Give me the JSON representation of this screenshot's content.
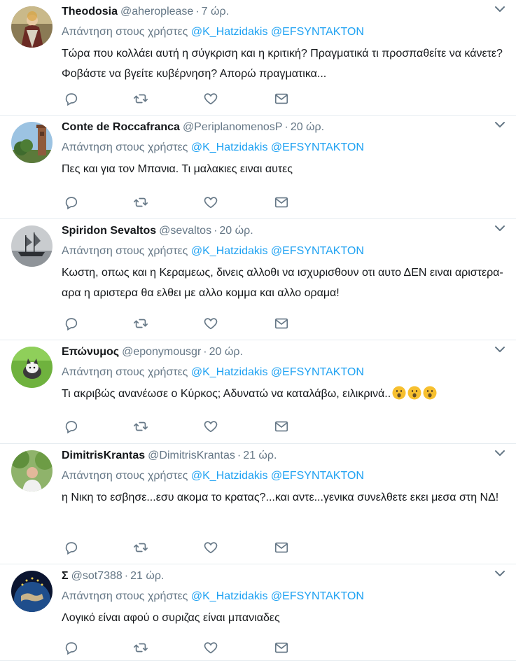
{
  "colors": {
    "link": "#1da1f2",
    "muted": "#657786",
    "text": "#14171a",
    "divider": "#e6ecf0"
  },
  "reply_prefix": "Απάντηση στους χρήστες",
  "tweets": [
    {
      "name": "Theodosia",
      "handle": "@aheroplease",
      "time": "7 ώρ.",
      "mentions": [
        "@K_Hatzidakis",
        "@EFSYNTAKTON"
      ],
      "text": "Τώρα που κολλάει αυτή η σύγκριση και η κριτική? Πραγματικά τι προσπαθείτε να κάνετε? Φοβάστε να βγείτε κυβέρνηση? Απορώ πραγματικα...",
      "avatar_icon": "painting-avatar"
    },
    {
      "name": "Conte de Roccafranca",
      "handle": "@PeriplanomenosP",
      "time": "20 ώρ.",
      "mentions": [
        "@K_Hatzidakis",
        "@EFSYNTAKTON"
      ],
      "text": "Πες και για τον Μπανια. Τι μαλακιες ειναι αυτες",
      "avatar_icon": "tower-avatar"
    },
    {
      "name": "Spiridon Sevaltos",
      "handle": "@sevaltos",
      "time": "20 ώρ.",
      "mentions": [
        "@K_Hatzidakis",
        "@EFSYNTAKTON"
      ],
      "text": "Κωστη, οπως και η Κεραμεως, δινεις αλλοθι να ισχυρισθουν οτι αυτο ΔΕΝ ειναι αριστερα-αρα η αριστερα θα ελθει με αλλο κομμα και αλλο οραμα!",
      "avatar_icon": "ship-avatar"
    },
    {
      "name": "Επώνυμος",
      "handle": "@eponymousgr",
      "time": "20 ώρ.",
      "mentions": [
        "@K_Hatzidakis",
        "@EFSYNTAKTON"
      ],
      "text": "Τι ακριβώς ανανέωσε ο Κύρκος; Αδυνατώ να καταλάβω, ειλικρινά..",
      "emoji_count": 3,
      "avatar_icon": "cat-avatar"
    },
    {
      "name": "DimitrisKrantas",
      "handle": "@DimitrisKrantas",
      "time": "21 ώρ.",
      "mentions": [
        "@K_Hatzidakis",
        "@EFSYNTAKTON"
      ],
      "text": "η Νικη το εσβησε...εσυ ακομα το κρατας?...και αντε...γενικα συνελθετε εκει μεσα στη ΝΔ!",
      "avatar_icon": "portrait-avatar"
    },
    {
      "name": "Σ",
      "handle": "@sot7388",
      "time": "21 ώρ.",
      "mentions": [
        "@K_Hatzidakis",
        "@EFSYNTAKTON"
      ],
      "text": "Λογικό είναι αφού ο συριζας είναι μπανιαδες",
      "avatar_icon": "earth-avatar"
    }
  ]
}
